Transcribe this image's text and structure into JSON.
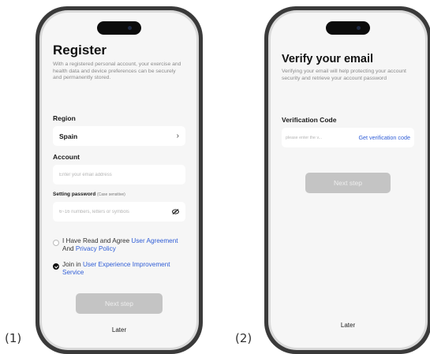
{
  "labels": {
    "fig1": "(1)",
    "fig2": "(2)"
  },
  "register": {
    "title": "Register",
    "description": "With a registered personal account, your exercise and health data and device preferences can be securely and permanently stored.",
    "region_label": "Region",
    "region_value": "Spain",
    "account_label": "Account",
    "account_placeholder": "Enter your email address",
    "password_label": "Setting password",
    "password_hint": "(Case sensitive)",
    "password_placeholder": "6~16 numbers, letters or symbols",
    "agree_text": "I Have Read and Agree ",
    "agree_link1": "User Agreement",
    "agree_and": " And ",
    "agree_link2": "Privacy Policy",
    "join_text": "Join in ",
    "join_link": "User Experience Improvement Service",
    "next_button": "Next step",
    "later": "Later"
  },
  "verify": {
    "title": "Verify your email",
    "description": "Verifying your email will help protecting your account security and retrieve your account password",
    "code_label": "Verification Code",
    "code_placeholder": "please enter the v...",
    "get_code": "Get verification code",
    "next_button": "Next step",
    "later": "Later"
  },
  "colors": {
    "link": "#2f5dd6",
    "button_disabled": "#c4c4c4",
    "screen_bg": "#f6f6f6"
  }
}
